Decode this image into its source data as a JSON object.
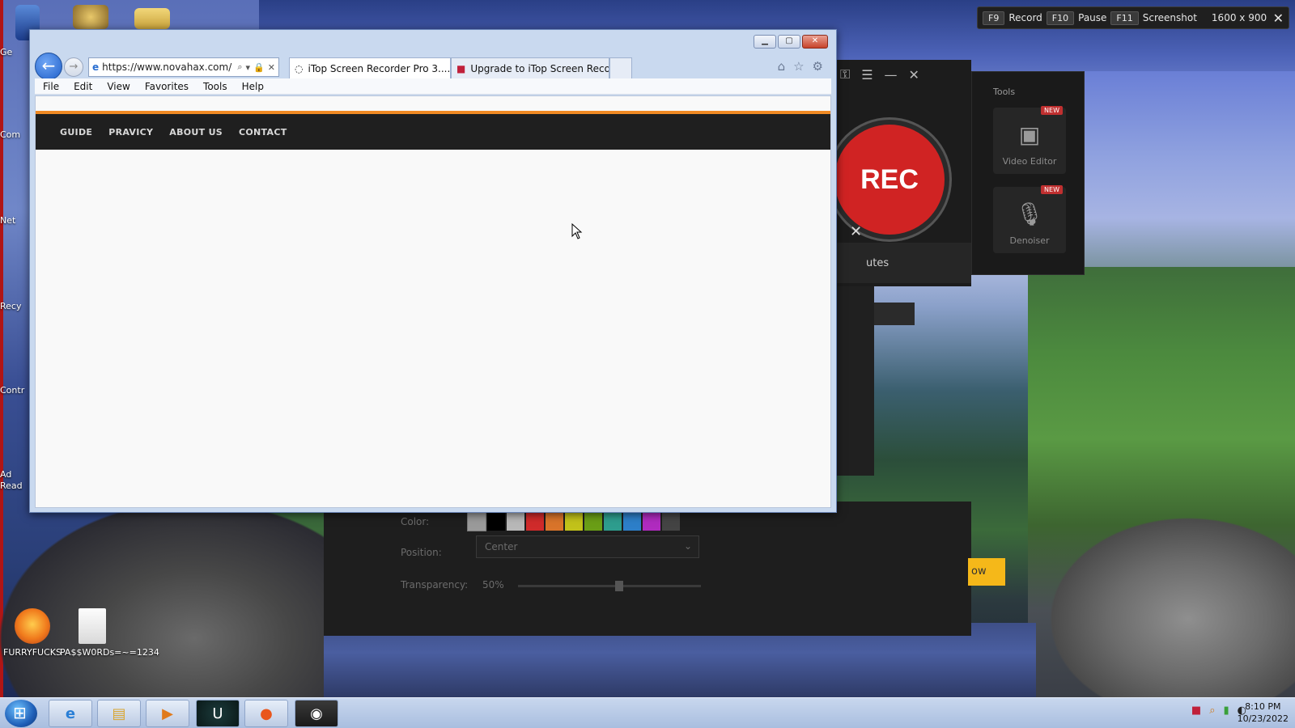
{
  "recorder_bar": {
    "record_key": "F9",
    "record_label": "Record",
    "pause_key": "F10",
    "pause_label": "Pause",
    "screenshot_key": "F11",
    "screenshot_label": "Screenshot",
    "resolution": "1600 x 900",
    "close_icon": "close-icon"
  },
  "itop": {
    "rec_label": "REC",
    "minutes_text": "utes",
    "tools_title": "Tools",
    "tools": [
      {
        "label": "Video Editor",
        "badge": "NEW",
        "icon": "film-edit-icon"
      },
      {
        "label": "Denoiser",
        "badge": "NEW",
        "icon": "mic-icon"
      }
    ],
    "watermark": {
      "color_label": "Color:",
      "swatches": [
        "#9a9a9a",
        "#000000",
        "#b8b8b8",
        "#d02b2b",
        "#d9742a",
        "#c2c21a",
        "#6a9e16",
        "#2e9d8e",
        "#2d7fc9",
        "#b02bbf",
        "#444444"
      ],
      "position_label": "Position:",
      "position_value": "Center",
      "transparency_label": "Transparency:",
      "transparency_value": "50%"
    },
    "partial_button": "ow"
  },
  "browser": {
    "url": "https://www.novahax.com/",
    "tabs": [
      {
        "label": "iTop Screen Recorder Pro 3...."
      },
      {
        "label": "Upgrade to iTop Screen Recor..."
      }
    ],
    "menu": [
      "File",
      "Edit",
      "View",
      "Favorites",
      "Tools",
      "Help"
    ],
    "site_nav": [
      "GUIDE",
      "PRAVICY",
      "ABOUT US",
      "CONTACT"
    ]
  },
  "desktop_icons": [
    {
      "label": "FURRYFUCKS"
    },
    {
      "label": "PA$$W0RDs=~=1234"
    }
  ],
  "side_labels": [
    "Ge",
    "Com",
    "Net",
    "Recy",
    "Contr",
    "Ad",
    "Read"
  ],
  "taskbar": {
    "apps": [
      "ie-icon",
      "folder-icon",
      "media-player-icon",
      "u-app-icon",
      "firefox-icon",
      "recorder-icon"
    ],
    "time": "8:10 PM",
    "date": "10/23/2022"
  }
}
